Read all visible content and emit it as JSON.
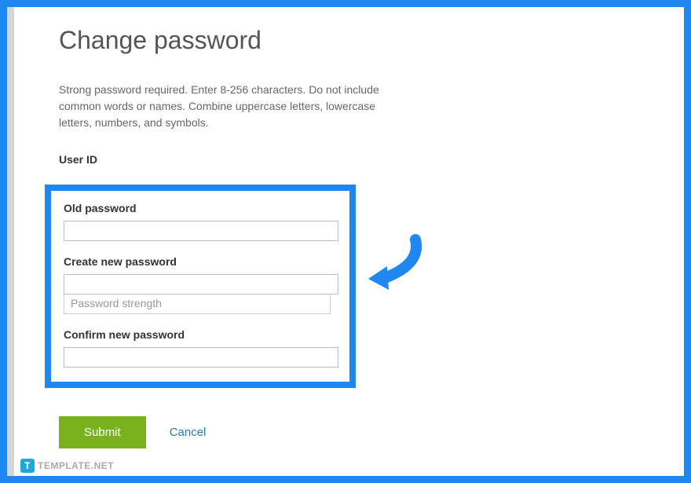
{
  "title": "Change password",
  "description": "Strong password required. Enter 8-256 characters. Do not include common words or names. Combine uppercase letters, lowercase letters, numbers, and symbols.",
  "user_id_label": "User ID",
  "form": {
    "old_password": {
      "label": "Old password",
      "value": ""
    },
    "new_password": {
      "label": "Create new password",
      "value": "",
      "strength_label": "Password strength"
    },
    "confirm_password": {
      "label": "Confirm new password",
      "value": ""
    }
  },
  "actions": {
    "submit": "Submit",
    "cancel": "Cancel"
  },
  "watermark": {
    "icon_letter": "T",
    "text": "TEMPLATE.NET"
  }
}
